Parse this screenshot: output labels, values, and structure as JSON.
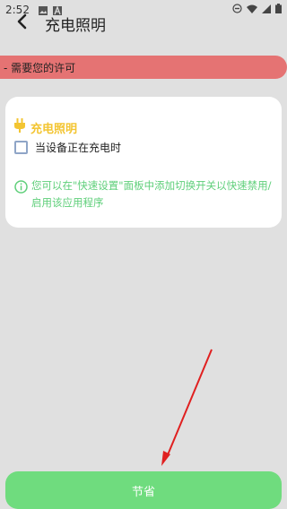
{
  "status_bar": {
    "time": "2:52",
    "icons": [
      "image-icon",
      "text-a-icon",
      "dnd-icon",
      "wifi-icon",
      "signal-icon",
      "battery-icon"
    ]
  },
  "app_bar": {
    "title": "充电照明",
    "back_icon": "back-arrow-icon"
  },
  "permission_banner": {
    "text": "- 需要您的许可",
    "color": "#e57373"
  },
  "card": {
    "title": "充电照明",
    "title_icon": "plug-icon",
    "title_color": "#f3c532",
    "checkbox": {
      "label": "当设备正在充电时",
      "checked": false
    },
    "info": {
      "icon": "info-icon",
      "text": "您可以在\"快速设置\"面板中添加切换开关以快速禁用/启用该应用程序",
      "color": "#5fcf7a"
    }
  },
  "save_button": {
    "label": "节省",
    "color": "#6fdc7e"
  },
  "annotation": {
    "type": "red-arrow",
    "color": "#e02020"
  }
}
